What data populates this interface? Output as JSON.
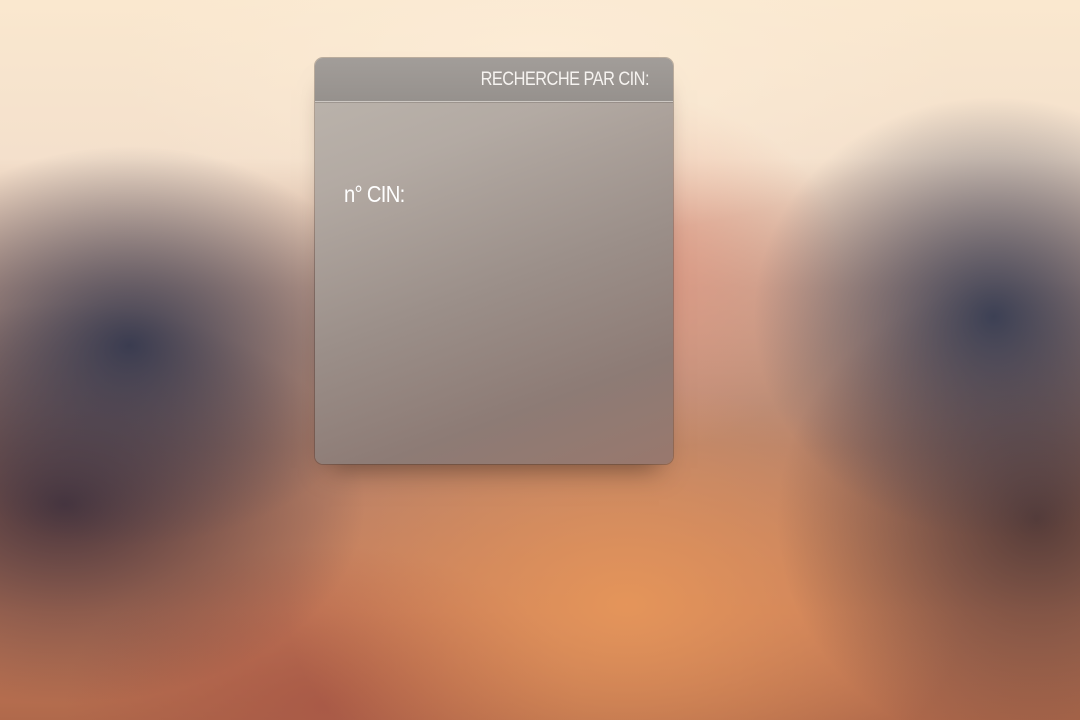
{
  "panel": {
    "title": "RECHERCHE PAR CIN:",
    "field_label": "n° CIN:"
  }
}
